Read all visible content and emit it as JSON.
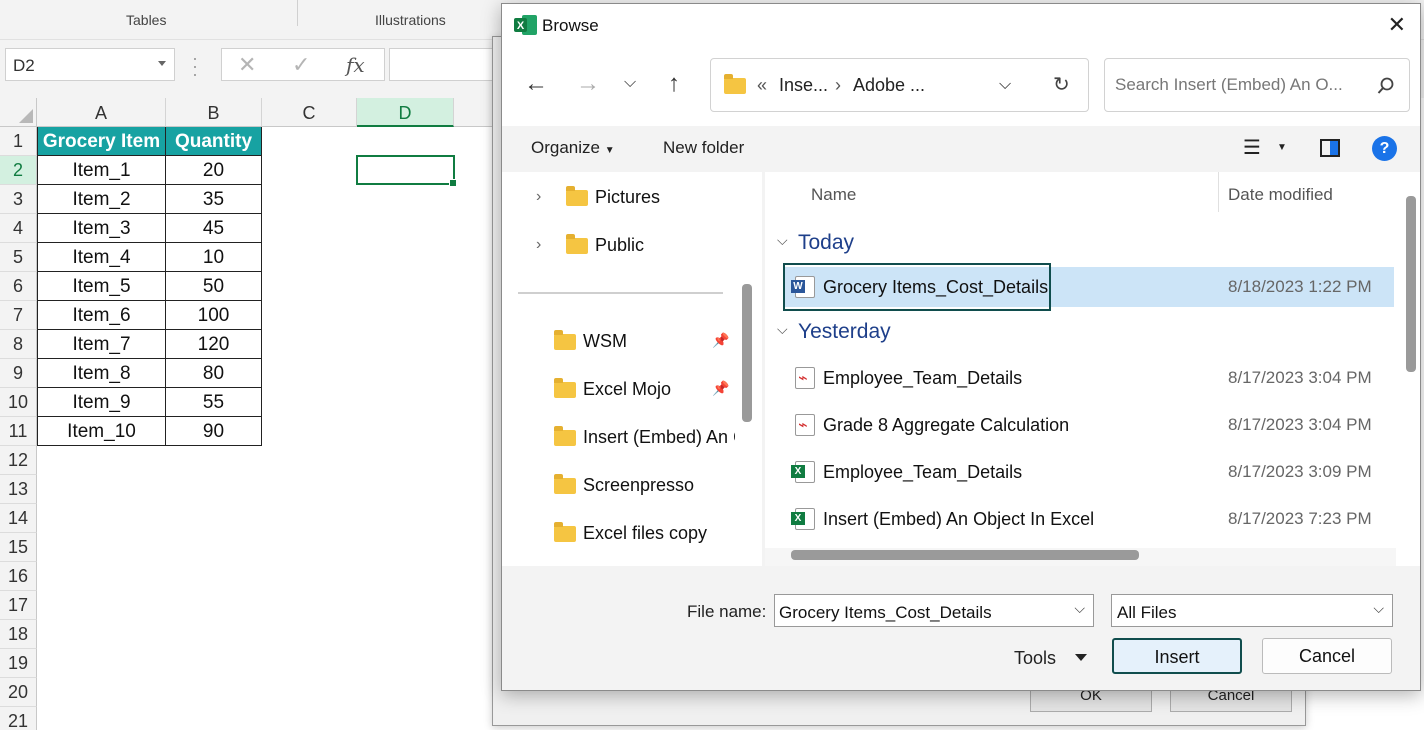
{
  "excel": {
    "ribbon_groups": [
      "Tables",
      "Illustrations"
    ],
    "name_box": "D2",
    "columns": [
      "A",
      "B",
      "C",
      "D"
    ],
    "rows": [
      "1",
      "2",
      "3",
      "4",
      "5",
      "6",
      "7",
      "8",
      "9",
      "10",
      "11",
      "12",
      "13",
      "14",
      "15",
      "16",
      "17",
      "18",
      "19",
      "20",
      "21"
    ],
    "selected_column": "D",
    "selected_row": "2",
    "table_headers": [
      "Grocery Item",
      "Quantity"
    ],
    "table_rows": [
      [
        "Item_1",
        "20"
      ],
      [
        "Item_2",
        "35"
      ],
      [
        "Item_3",
        "45"
      ],
      [
        "Item_4",
        "10"
      ],
      [
        "Item_5",
        "50"
      ],
      [
        "Item_6",
        "100"
      ],
      [
        "Item_7",
        "120"
      ],
      [
        "Item_8",
        "80"
      ],
      [
        "Item_9",
        "55"
      ],
      [
        "Item_10",
        "90"
      ]
    ],
    "header_color": "#17a2a2",
    "accent_color": "#107c41"
  },
  "underlying_dialog": {
    "ok_label": "OK",
    "cancel_label": "Cancel"
  },
  "dialog": {
    "title": "Browse",
    "address": {
      "prefix": "«",
      "crumb1": "Inse...",
      "crumb2": "Adobe ..."
    },
    "search_placeholder": "Search Insert (Embed) An O...",
    "toolbar": {
      "organize": "Organize",
      "new_folder": "New folder",
      "help": "?"
    },
    "nav_items": [
      {
        "label": "Pictures",
        "expandable": true
      },
      {
        "label": "Public",
        "expandable": true
      },
      {
        "label": "WSM",
        "pinned": true
      },
      {
        "label": "Excel Mojo",
        "pinned": true
      },
      {
        "label": "Insert (Embed) An C",
        "pinned": false
      },
      {
        "label": "Screenpresso",
        "pinned": false
      },
      {
        "label": "Excel files copy",
        "pinned": false
      }
    ],
    "columns": {
      "name": "Name",
      "date_modified": "Date modified"
    },
    "groups": [
      {
        "label": "Today",
        "files": [
          {
            "name": "Grocery Items_Cost_Details",
            "date": "8/18/2023 1:22 PM",
            "type": "word",
            "selected": true
          }
        ]
      },
      {
        "label": "Yesterday",
        "files": [
          {
            "name": "Employee_Team_Details",
            "date": "8/17/2023 3:04 PM",
            "type": "pdf"
          },
          {
            "name": "Grade 8 Aggregate Calculation",
            "date": "8/17/2023 3:04 PM",
            "type": "pdf"
          },
          {
            "name": "Employee_Team_Details",
            "date": "8/17/2023 3:09 PM",
            "type": "xls"
          },
          {
            "name": "Insert (Embed) An Object In Excel",
            "date": "8/17/2023 7:23 PM",
            "type": "xls"
          }
        ]
      }
    ],
    "file_name_label": "File name:",
    "file_name_value": "Grocery Items_Cost_Details",
    "file_type_value": "All Files",
    "tools_label": "Tools",
    "insert_label": "Insert",
    "cancel_label": "Cancel",
    "selection_color": "#cce4f7",
    "group_label_color": "#1e3f8a"
  }
}
